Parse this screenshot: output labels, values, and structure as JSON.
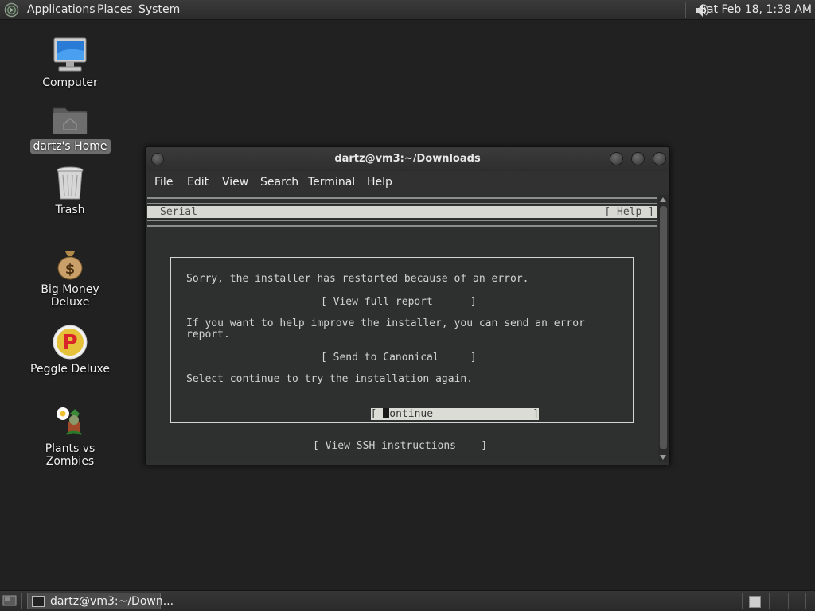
{
  "top_panel": {
    "menus": [
      "Applications",
      "Places",
      "System"
    ],
    "clock": "Sat Feb 18,  1:38 AM"
  },
  "desktop_icons": [
    {
      "label": "Computer",
      "icon": "computer-icon"
    },
    {
      "label": "dartz's Home",
      "icon": "home-folder-icon",
      "selected": true
    },
    {
      "label": "Trash",
      "icon": "trash-icon"
    },
    {
      "label": "Big Money Deluxe",
      "icon": "money-bag-icon"
    },
    {
      "label": "Peggle Deluxe",
      "icon": "peggle-icon"
    },
    {
      "label": "Plants vs Zombies",
      "icon": "plants-vs-zombies-icon"
    }
  ],
  "window": {
    "title": "dartz@vm3:~/Downloads",
    "menu": [
      "File",
      "Edit",
      "View",
      "Search",
      "Terminal",
      "Help"
    ]
  },
  "terminal": {
    "header_left": "Serial",
    "header_right": "[ Help ]",
    "error_line": "Sorry, the installer has restarted because of an error.",
    "view_report_button": "[ View full report      ]",
    "help_text_1": "If you want to help improve the installer, you can send an error",
    "help_text_2": "report.",
    "send_button": "[ Send to Canonical     ]",
    "select_text": "Select continue to try the installation again.",
    "continue_button_left": "[ ",
    "continue_button_cursor_char": "C",
    "continue_button_rest": "ontinue                ]",
    "ssh_button": "[ View SSH instructions    ]"
  },
  "taskbar": {
    "task_label": "dartz@vm3:~/Down..."
  },
  "colors": {
    "desktop_bg": "#212121",
    "terminal_bg": "#2e3030",
    "highlight": "#dcdcd6"
  }
}
